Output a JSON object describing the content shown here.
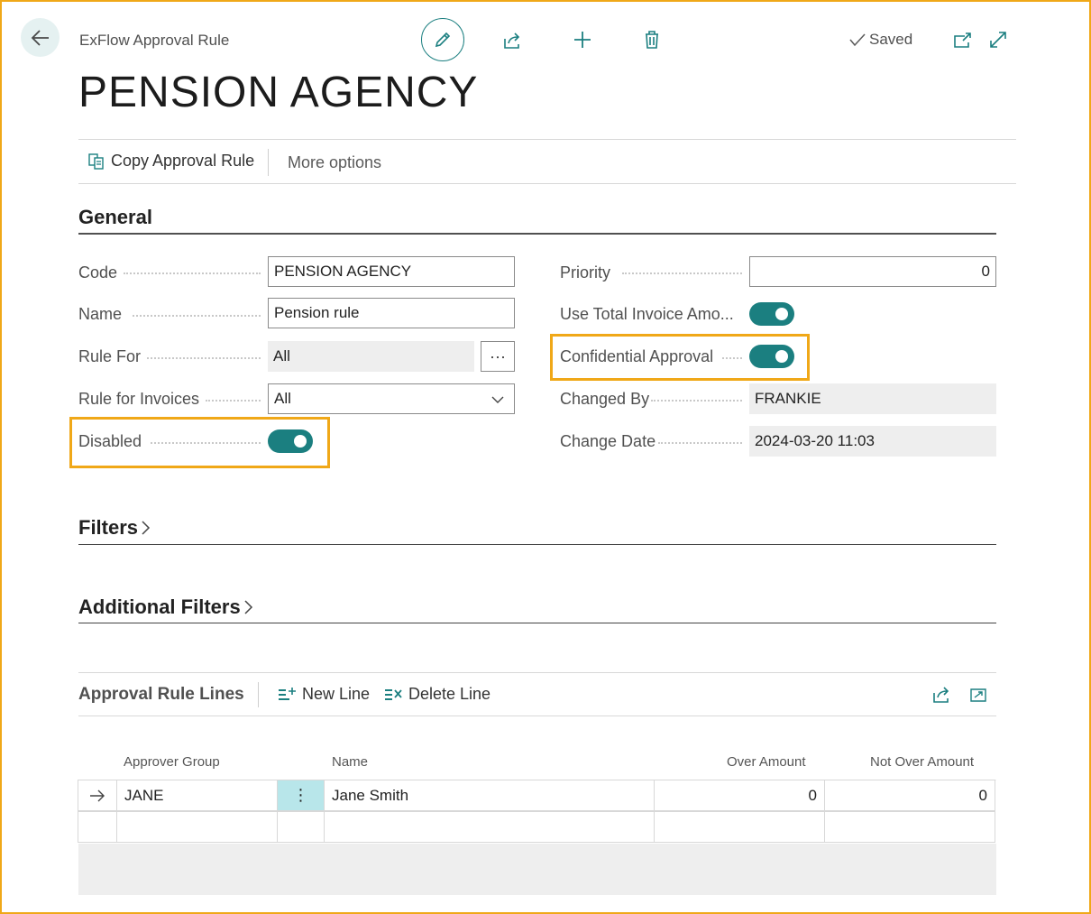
{
  "header": {
    "breadcrumb": "ExFlow Approval Rule",
    "status": "Saved",
    "title": "PENSION AGENCY"
  },
  "actions": {
    "copy": "Copy Approval Rule",
    "more": "More options"
  },
  "general": {
    "title": "General",
    "code": {
      "label": "Code",
      "value": "PENSION AGENCY"
    },
    "name": {
      "label": "Name",
      "value": "Pension rule"
    },
    "rule_for": {
      "label": "Rule For",
      "value": "All"
    },
    "rule_for_invoices": {
      "label": "Rule for Invoices",
      "value": "All"
    },
    "disabled": {
      "label": "Disabled",
      "on": true
    },
    "priority": {
      "label": "Priority",
      "value": "0"
    },
    "use_total": {
      "label": "Use Total Invoice Amo...",
      "on": true
    },
    "confidential": {
      "label": "Confidential Approval",
      "on": true
    },
    "changed_by": {
      "label": "Changed By",
      "value": "FRANKIE"
    },
    "change_date": {
      "label": "Change Date",
      "value": "2024-03-20 11:03"
    }
  },
  "filters": {
    "title": "Filters"
  },
  "additional_filters": {
    "title": "Additional Filters"
  },
  "lines": {
    "title": "Approval Rule Lines",
    "new_line": "New Line",
    "delete_line": "Delete Line",
    "columns": [
      "Approver Group",
      "Name",
      "Over Amount",
      "Not Over Amount"
    ],
    "rows": [
      {
        "approver_group": "JANE",
        "name": "Jane Smith",
        "over_amount": "0",
        "not_over_amount": "0"
      }
    ]
  },
  "colors": {
    "accent": "#1b7f80",
    "highlight": "#f0a818"
  }
}
